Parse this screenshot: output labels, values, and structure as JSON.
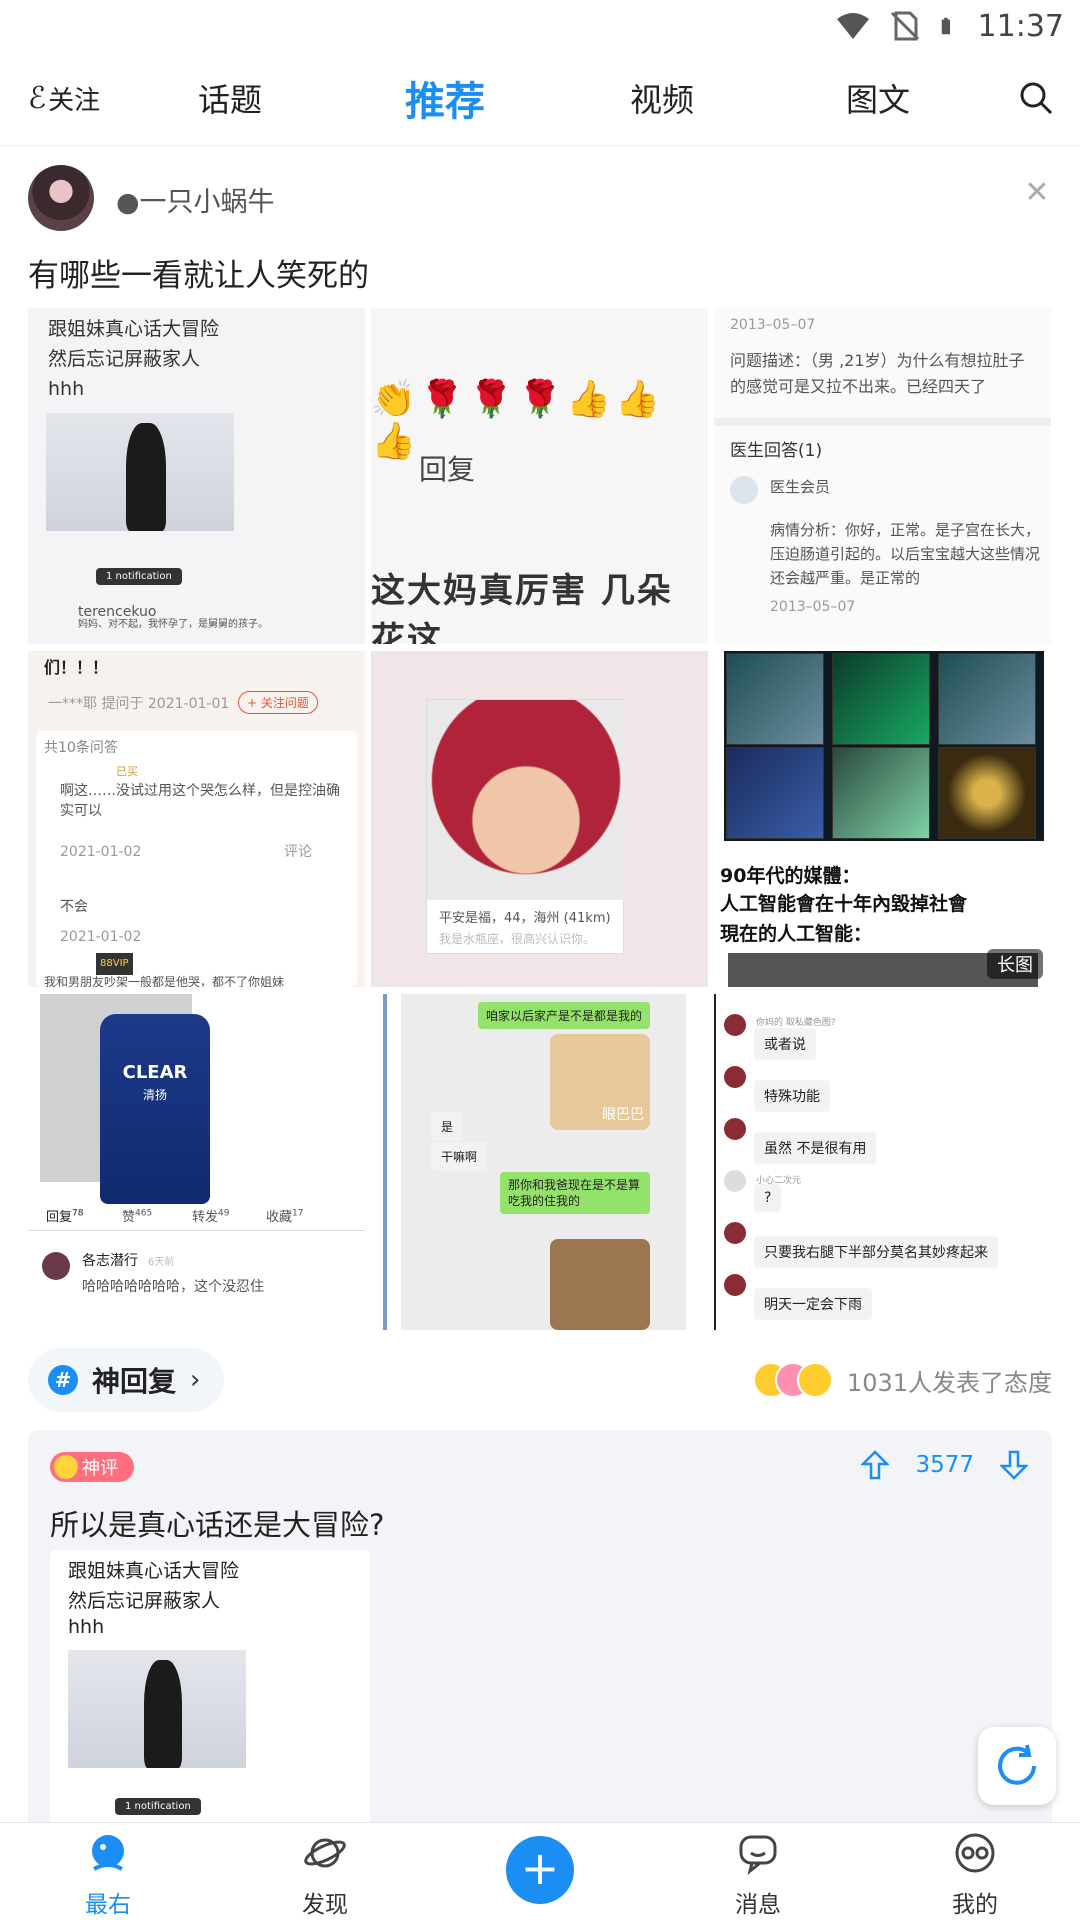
{
  "status_bar": {
    "time": "11:37"
  },
  "top_nav": {
    "follow": "关注",
    "tabs": [
      "话题",
      "推荐",
      "视频",
      "图文"
    ],
    "active_tab": "推荐"
  },
  "post": {
    "author": "●一只小蜗牛",
    "title": "有哪些一看就让人笑死的",
    "tiles": {
      "t1": {
        "line1": "跟姐妹真心话大冒险",
        "line2": "然后忘记屏蔽家人",
        "line3": "hhh",
        "chip": "1 notification",
        "user": "terencekuo",
        "caption": "妈妈、对不起，我怀孕了，是舅舅的孩子。"
      },
      "t2": {
        "reply": "回复",
        "big": "这大妈真厉害 几朵花这"
      },
      "t3": {
        "date1": "2013–05–07",
        "question": "问题描述：（男 ,21岁）为什么有想拉肚子的感觉可是又拉不出来。已经四天了",
        "section": "医生回答(1)",
        "member": "医生会员",
        "answer": "病情分析：你好，正常。是子宫在长大，压迫肠道引起的。以后宝宝越大这些情况还会越严重。是正常的",
        "date2": "2013–05–07"
      },
      "t4": {
        "header": "们！！！",
        "asker": "一***耶  提问于 2021-01-01",
        "follow_btn": "+ 关注问题",
        "count": "共10条问答",
        "a1": "啊这……没试过用这个哭怎么样，但是控油确实可以",
        "d1": "2021-01-02",
        "a2": "不会",
        "d2": "2021-01-02",
        "a3": "我和男朋友吵架一般都是他哭，都不了你姐妹",
        "comment": "评论",
        "vip": "88VIP",
        "bought": "已买"
      },
      "t5": {
        "caption": "平安是福，44，海州 (41km)",
        "sub": "我是水瓶座，很高兴认识你。"
      },
      "t6": {
        "line1": "90年代的媒體：",
        "line2": "人工智能會在十年內毀掉社會",
        "line3": "現在的人工智能：",
        "badge": "长图"
      },
      "t7": {
        "brand": "CLEAR",
        "brand_cn": "清扬",
        "tab_reply": "回复",
        "reply_n": "78",
        "tab_like": "赞",
        "like_n": "465",
        "tab_share": "转发",
        "share_n": "49",
        "tab_fav": "收藏",
        "fav_n": "17",
        "user": "各志潜行",
        "time": "6天前",
        "text": "哈哈哈哈哈哈哈，这个没忍住"
      },
      "t8": {
        "m1": "咱家以后家产是不是都是我的",
        "m2": "是",
        "m3": "干嘛啊",
        "m4": "那你和我爸现在是不是算吃我的住我的",
        "sticker": "眼巴巴"
      },
      "t9": {
        "m1": "或者说",
        "m2": "特殊功能",
        "m3": "虽然 不是很有用",
        "m4": "?",
        "m5": "只要我右腿下半部分莫名其妙疼起来",
        "m6": "明天一定会下雨",
        "who": "你妈的 取私藏色图?",
        "who2": "小心二次元"
      }
    }
  },
  "topic": {
    "name": "神回复",
    "attitude": "1031人发表了态度"
  },
  "god_comment": {
    "badge": "神评",
    "votes": "3577",
    "text": "所以是真心话还是大冒险?",
    "img_line1": "跟姐妹真心话大冒险",
    "img_line2": "然后忘记屏蔽家人",
    "img_line3": "hhh",
    "img_chip": "1 notification"
  },
  "tabbar": {
    "home": "最右",
    "discover": "发现",
    "messages": "消息",
    "me": "我的"
  },
  "colors": {
    "accent": "#1a8ef2",
    "shen_badge": "#ff6f7d"
  },
  "icons": [
    "wifi-icon",
    "no-sim-icon",
    "battery-icon",
    "search-icon",
    "close-icon",
    "refresh-icon",
    "plus-icon"
  ]
}
